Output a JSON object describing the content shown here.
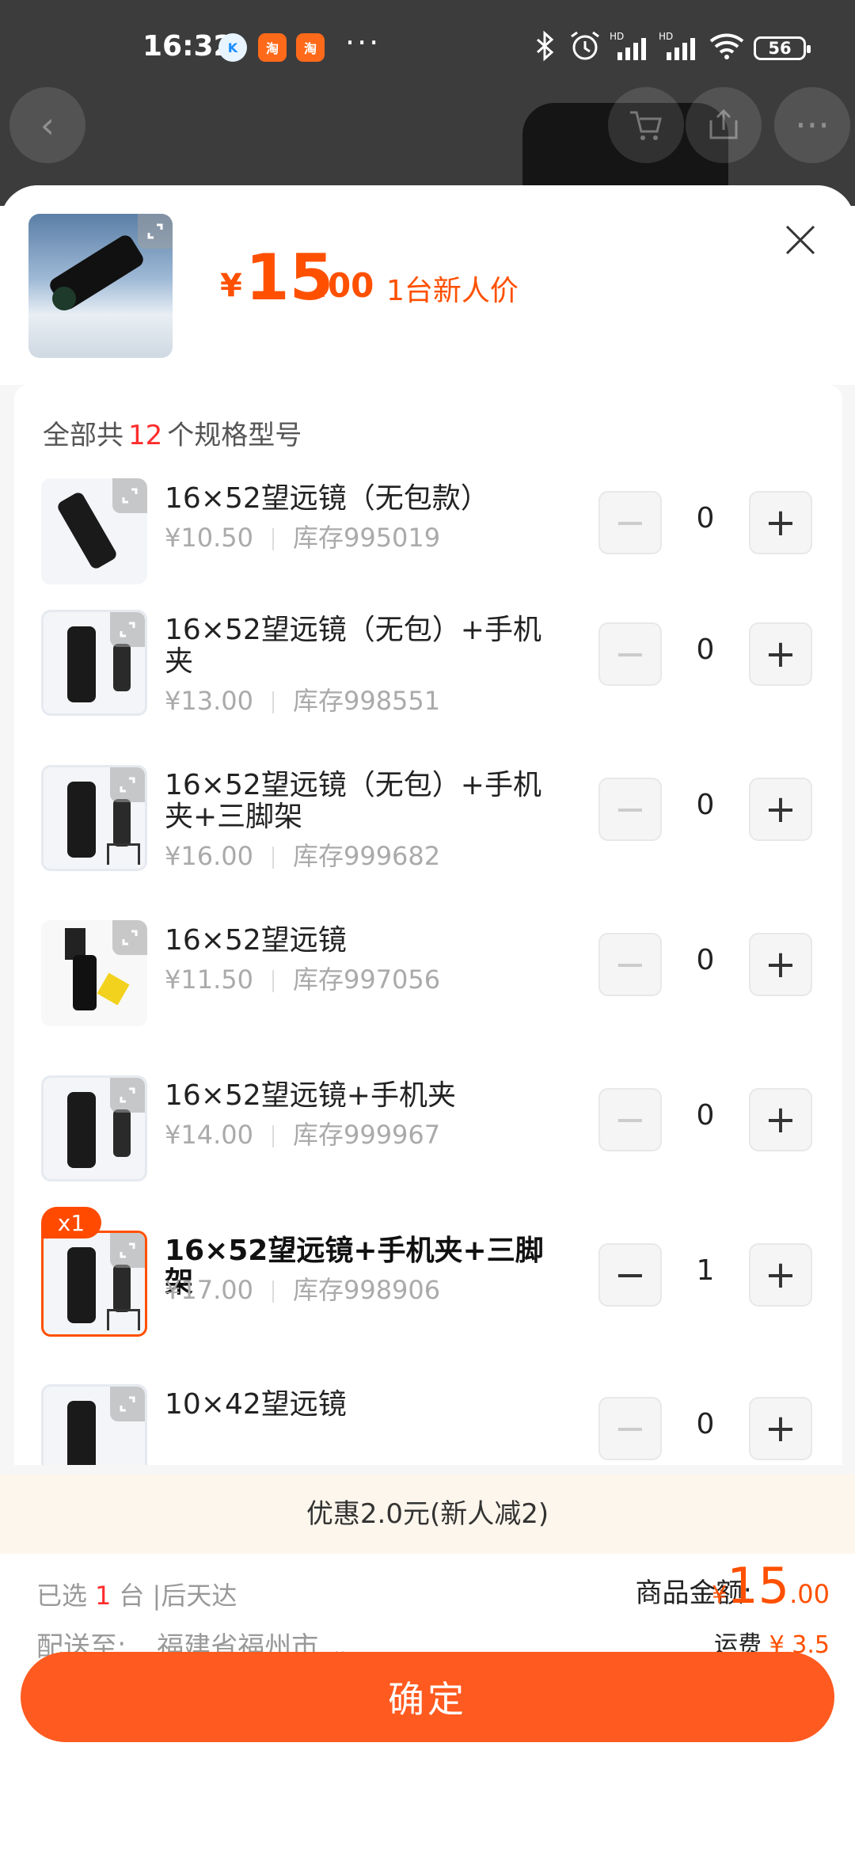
{
  "status_bar": {
    "time": "16:32",
    "battery": "56"
  },
  "sheet": {
    "price_currency": "¥",
    "price_int": "15",
    "price_dec": ".00",
    "price_tag": "1台新人价"
  },
  "list": {
    "count_prefix": "全部共",
    "count": "12",
    "count_suffix": "个规格型号",
    "items": [
      {
        "name": "16×52望远镜（无包款）",
        "price": "¥10.50",
        "stock": "库存995019",
        "qty": "0"
      },
      {
        "name": "16×52望远镜（无包）+手机夹",
        "price": "¥13.00",
        "stock": "库存998551",
        "qty": "0"
      },
      {
        "name": "16×52望远镜（无包）+手机夹+三脚架",
        "price": "¥16.00",
        "stock": "库存999682",
        "qty": "0"
      },
      {
        "name": "16×52望远镜",
        "price": "¥11.50",
        "stock": "库存997056",
        "qty": "0"
      },
      {
        "name": "16×52望远镜+手机夹",
        "price": "¥14.00",
        "stock": "库存999967",
        "qty": "0"
      },
      {
        "name": "16×52望远镜+手机夹+三脚架",
        "price": "¥17.00",
        "stock": "库存998906",
        "qty": "1",
        "badge": "x1"
      },
      {
        "name": "10×42望远镜",
        "price": "",
        "stock": "",
        "qty": "0"
      }
    ]
  },
  "promo": "优惠2.0元(新人减2)",
  "footer": {
    "selected_prefix": "已选",
    "selected_count": "1",
    "selected_suffix": "台 |后天达",
    "ship_to_label": "配送至:",
    "ship_to_value": "福建省福州市",
    "amount_label": "商品金额:",
    "amount_currency": "¥",
    "amount_int": "15",
    "amount_dec": ".00",
    "freight_label": "运费",
    "freight_value": "¥ 3.5",
    "confirm": "确定"
  },
  "colors": {
    "accent": "#ff5000",
    "confirm_bg": "#ff5a1f",
    "promo_bg": "#fdf6ec"
  }
}
